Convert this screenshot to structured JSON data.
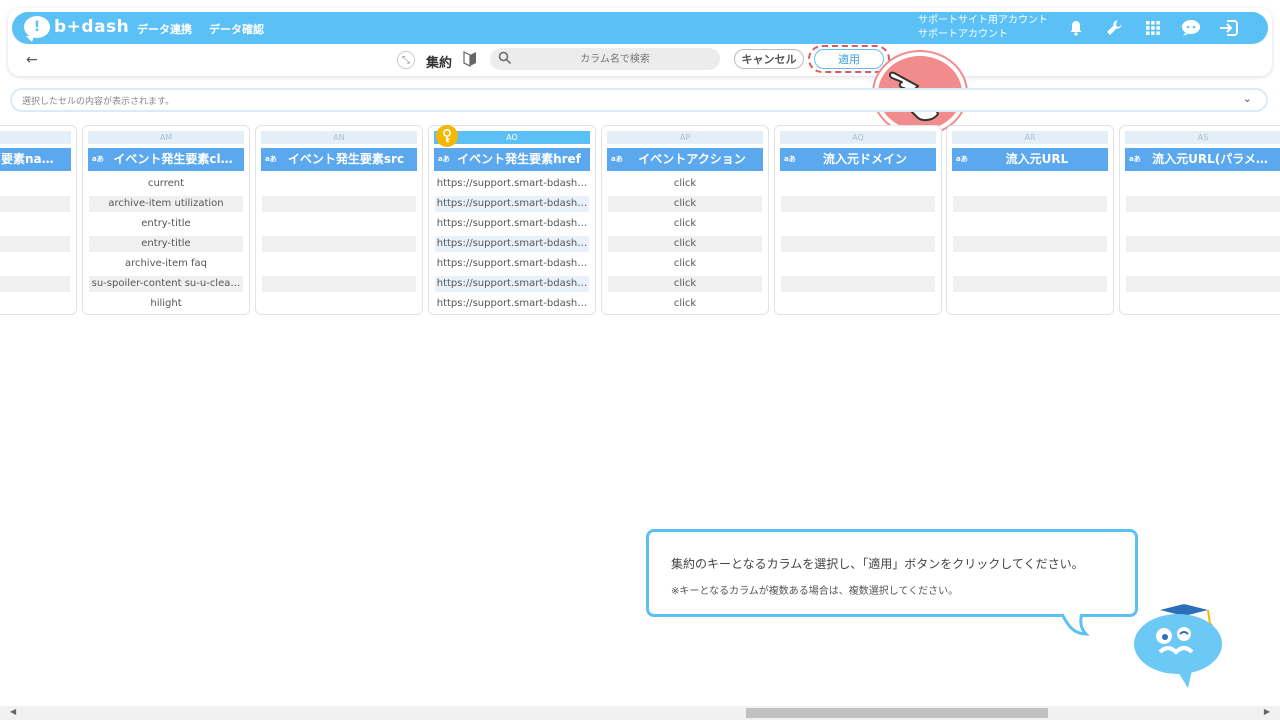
{
  "header": {
    "logo_text": "b+dash",
    "nav": [
      "データ連携",
      "データ確認"
    ],
    "account_line1": "サポートサイト用アカウント",
    "account_line2": "サポートアカウント"
  },
  "toolbar": {
    "back": "←",
    "aggregate_label": "集約",
    "search_placeholder": "カラム名で検索",
    "cancel_label": "キャンセル",
    "apply_label": "適用"
  },
  "cell_bar": {
    "placeholder": "選択したセルの内容が表示されます。",
    "chevron": "⌄"
  },
  "type_icon": "aあ",
  "columns": [
    {
      "letter": "",
      "name": "要素na…",
      "rows": [
        "",
        "",
        "",
        "",
        "",
        "",
        ""
      ]
    },
    {
      "letter": "AM",
      "name": "イベント発生要素cl…",
      "rows": [
        "current",
        "archive-item utilization",
        "entry-title",
        "entry-title",
        "archive-item faq",
        "su-spoiler-content su-u-clea…",
        "hilight"
      ]
    },
    {
      "letter": "AN",
      "name": "イベント発生要素src",
      "rows": [
        "",
        "",
        "",
        "",
        "",
        "",
        ""
      ]
    },
    {
      "letter": "AO",
      "name": "イベント発生要素href",
      "rows": [
        "https://support.smart-bdash…",
        "https://support.smart-bdash…",
        "https://support.smart-bdash…",
        "https://support.smart-bdash…",
        "https://support.smart-bdash…",
        "https://support.smart-bdash…",
        "https://support.smart-bdash…"
      ]
    },
    {
      "letter": "AP",
      "name": "イベントアクション",
      "rows": [
        "click",
        "click",
        "click",
        "click",
        "click",
        "click",
        "click"
      ]
    },
    {
      "letter": "AQ",
      "name": "流入元ドメイン",
      "rows": [
        "",
        "",
        "",
        "",
        "",
        "",
        ""
      ]
    },
    {
      "letter": "AR",
      "name": "流入元URL",
      "rows": [
        "",
        "",
        "",
        "",
        "",
        "",
        ""
      ]
    },
    {
      "letter": "AS",
      "name": "流入元URL(パラメ…",
      "rows": [
        "",
        "",
        "",
        "",
        "",
        "",
        ""
      ]
    }
  ],
  "tooltip": {
    "line1": "集約のキーとなるカラムを選択し、「適用」ボタンをクリックしてください。",
    "line2": "※キーとなるカラムが複数ある場合は、複数選択してください。"
  },
  "colors": {
    "brand": "#5bc0f5",
    "header_col": "#5ba8ee",
    "accent_red": "#e05560",
    "key": "#f5b700"
  }
}
